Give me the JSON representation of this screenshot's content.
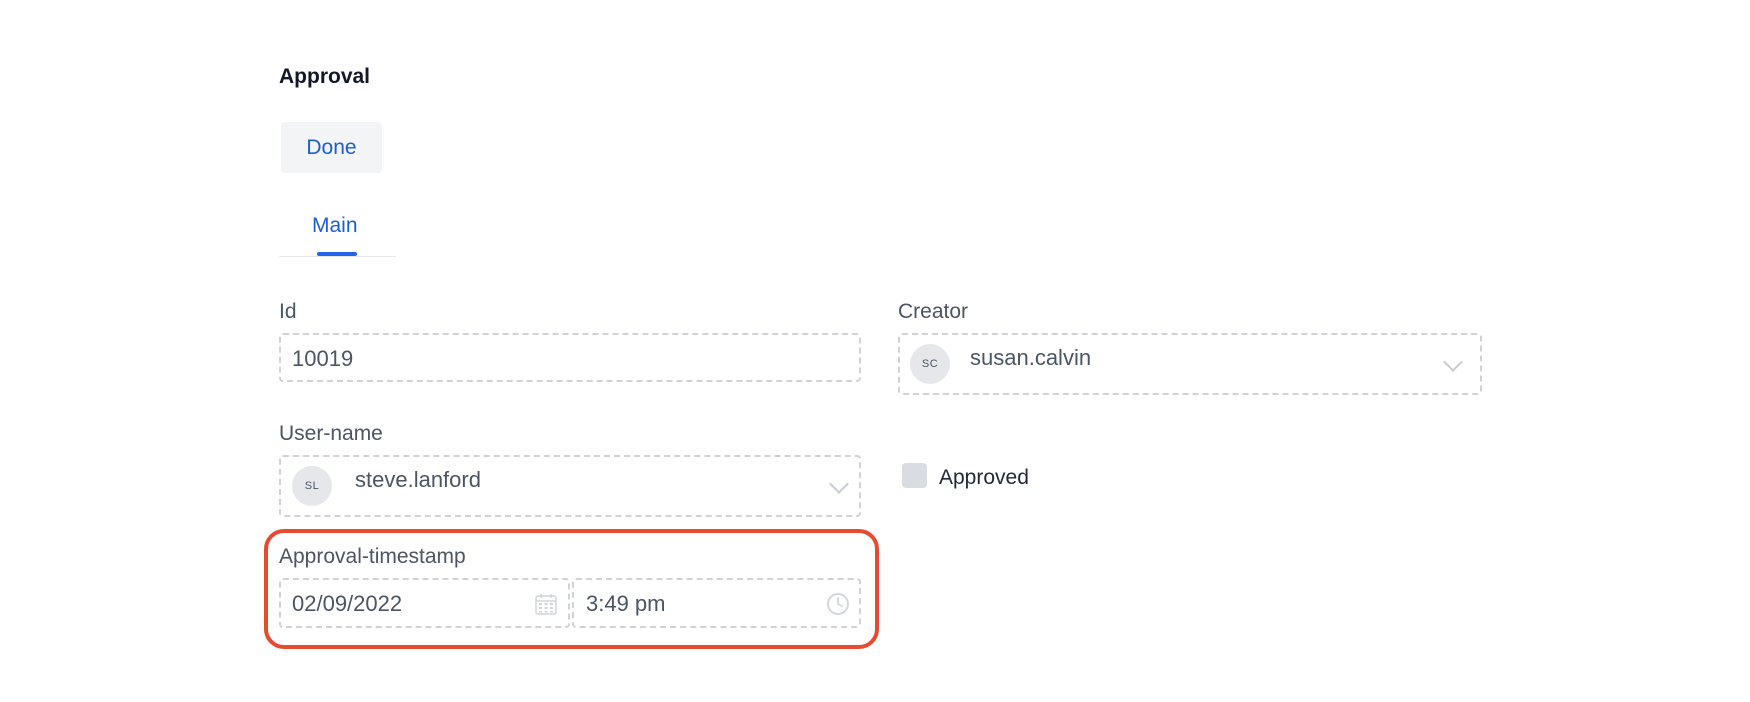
{
  "page": {
    "title": "Approval",
    "done_label": "Done"
  },
  "tabs": [
    {
      "label": "Main",
      "active": true
    }
  ],
  "form": {
    "id": {
      "label": "Id",
      "value": "10019"
    },
    "creator": {
      "label": "Creator",
      "avatar_initials": "SC",
      "value": "susan.calvin"
    },
    "user_name": {
      "label": "User-name",
      "avatar_initials": "SL",
      "value": "steve.lanford"
    },
    "approved": {
      "label": "Approved",
      "checked": false
    },
    "approval_timestamp": {
      "label": "Approval-timestamp",
      "date": "02/09/2022",
      "time": "3:49 pm"
    }
  },
  "colors": {
    "accent": "#1d5fcf",
    "highlight": "#e84a2f",
    "border_dashed": "#cfd3d8"
  },
  "icons": {
    "calendar": "calendar-icon",
    "clock": "clock-icon",
    "chevron": "chevron-down-icon"
  }
}
